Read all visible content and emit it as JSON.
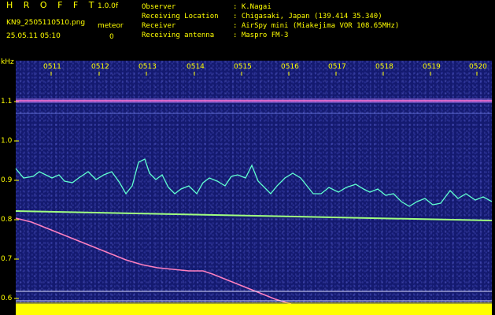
{
  "header": {
    "brand": "H R O F F T",
    "version": "1.0.0f",
    "filename": "KN9_2505110510.png",
    "counter_label": "meteor",
    "counter_value": "0",
    "datetime": "25.05.11 05:10",
    "info": [
      {
        "key": "Observer",
        "value": ": K.Nagai"
      },
      {
        "key": "Receiving Location",
        "value": ": Chigasaki, Japan (139.414 35.340)"
      },
      {
        "key": "Receiver",
        "value": ": AirSpy mini (Miakejima VOR 108.65MHz)"
      },
      {
        "key": "Receiving antenna",
        "value": ": Maspro FM-3"
      }
    ]
  },
  "axis": {
    "unit": "kHz",
    "y_ticks": [
      "1.1",
      "1.0",
      "0.9",
      "0.8",
      "0.7",
      "0.6"
    ],
    "x_ticks": [
      "0511",
      "0512",
      "0513",
      "0514",
      "0515",
      "0516",
      "0517",
      "0518",
      "0519",
      "0520"
    ]
  },
  "colors": {
    "label": "#ffff00",
    "background": "#141a70",
    "trace": "#60ffd0",
    "meteor_trail": "#ff80c0",
    "baseline": "#ffff00"
  }
}
